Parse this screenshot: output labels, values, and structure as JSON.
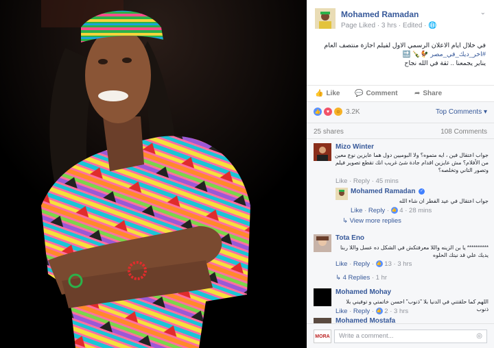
{
  "post": {
    "author": "Mohamed Ramadan",
    "meta": "Page Liked · 3 hrs · Edited ·",
    "text_line1": "في خلال ايام الاعلان الرسمي الاول لفيلم اجازة منتصف العام",
    "text_line2": "#اخر_ديك_في_مصر 🐓🍾 🔜",
    "text_line3": "يناير يجمعنا .. ثقة في الله نجاح",
    "actions": {
      "like": "Like",
      "comment": "Comment",
      "share": "Share"
    }
  },
  "feedback": {
    "reaction_count": "3.2K",
    "top_comments": "Top Comments ▾",
    "shares": "25 shares",
    "comments": "108 Comments"
  },
  "comments": [
    {
      "name": "Mizo Winter",
      "text_line1": "جواب اعتقال فين ، ايه متموه؟ ولا البوميين دول هما عايزين نوع معين",
      "text_line2": "من الأفلام؟ مش عايزين اقدام جادة شئ غريب انك تقطع تصوير فيلم",
      "text_line3": "وتصور التاني وتخلصه؟",
      "actions": "Like · Reply · 45 mins"
    },
    {
      "name": "Mohamed Ramadan",
      "text_line1": "جواب اعتقال في عيد الفطر ان شاء الله",
      "like": "Like",
      "reply": "Reply",
      "count": "4",
      "time": "28 mins",
      "more": "View more replies"
    },
    {
      "name": "Tota Eno",
      "text_line1": "**********  يا بن الزينه واللا معرفتكش في الشكل ده عسل واللا ربنا",
      "text_line2": "يديك علي قد نيتك الحلوه",
      "like": "Like",
      "reply": "Reply",
      "count": "13",
      "time": "3 hrs",
      "replies": "4 Replies",
      "replies_time": "1 hr"
    },
    {
      "name": "Mohamed Mohay",
      "text_line1": "اللهم كما حلقتني في الدنيا بلا \"ذنوب\" احسن خاتمتي و توفيني بلا ذنوب",
      "like": "Like",
      "reply": "Reply",
      "count": "2",
      "time": "3 hrs"
    },
    {
      "name": "Mohamed Mostafa"
    }
  ],
  "composer": {
    "avatar_text": "MORA",
    "placeholder": "Write a comment..."
  },
  "icons": {
    "chevron": "chevron-down-icon",
    "globe": "globe-icon",
    "like": "thumbs-up-icon",
    "comment": "speech-bubble-icon",
    "share": "share-arrow-icon",
    "camera": "camera-icon"
  },
  "colors": {
    "link": "#365899",
    "muted": "#90949c",
    "like_blue": "#5890ff",
    "love_red": "#f25268"
  }
}
